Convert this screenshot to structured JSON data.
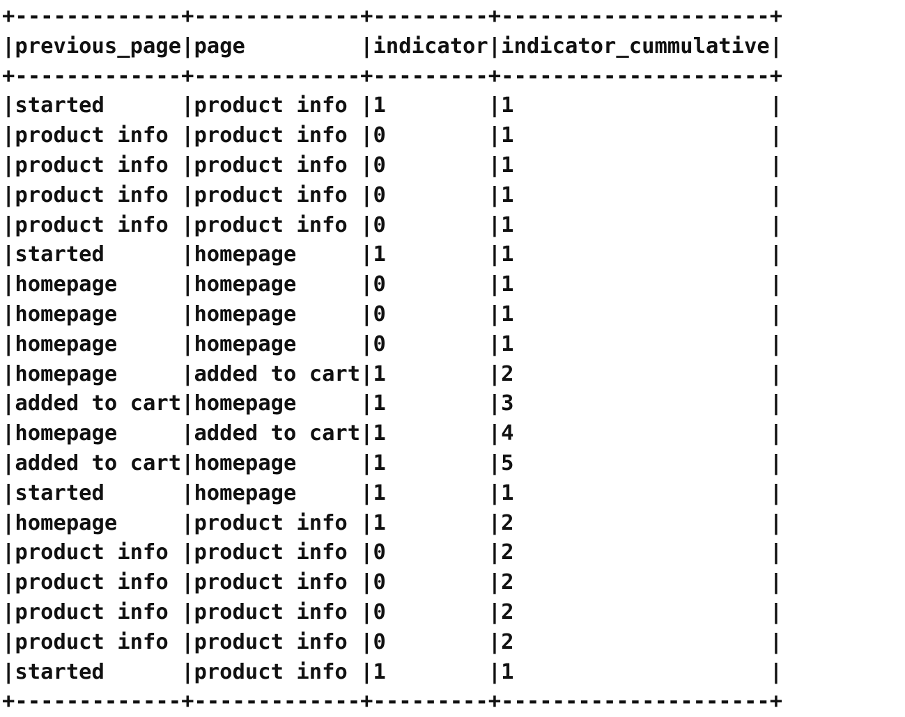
{
  "output": {
    "kind": "spark-dataframe-show",
    "border_corner": "+",
    "border_fill": "-",
    "cell_separator": "|",
    "columns": [
      {
        "name": "previous_page",
        "width": 13,
        "align": "left"
      },
      {
        "name": "page",
        "width": 13,
        "align": "left"
      },
      {
        "name": "indicator",
        "width": 9,
        "align": "left"
      },
      {
        "name": "indicator_cummulative",
        "width": 21,
        "align": "left"
      }
    ],
    "rows": [
      [
        "started",
        "product info",
        "1",
        "1"
      ],
      [
        "product info",
        "product info",
        "0",
        "1"
      ],
      [
        "product info",
        "product info",
        "0",
        "1"
      ],
      [
        "product info",
        "product info",
        "0",
        "1"
      ],
      [
        "product info",
        "product info",
        "0",
        "1"
      ],
      [
        "started",
        "homepage",
        "1",
        "1"
      ],
      [
        "homepage",
        "homepage",
        "0",
        "1"
      ],
      [
        "homepage",
        "homepage",
        "0",
        "1"
      ],
      [
        "homepage",
        "homepage",
        "0",
        "1"
      ],
      [
        "homepage",
        "added to cart",
        "1",
        "2"
      ],
      [
        "added to cart",
        "homepage",
        "1",
        "3"
      ],
      [
        "homepage",
        "added to cart",
        "1",
        "4"
      ],
      [
        "added to cart",
        "homepage",
        "1",
        "5"
      ],
      [
        "started",
        "homepage",
        "1",
        "1"
      ],
      [
        "homepage",
        "product info",
        "1",
        "2"
      ],
      [
        "product info",
        "product info",
        "0",
        "2"
      ],
      [
        "product info",
        "product info",
        "0",
        "2"
      ],
      [
        "product info",
        "product info",
        "0",
        "2"
      ],
      [
        "product info",
        "product info",
        "0",
        "2"
      ],
      [
        "started",
        "product info",
        "1",
        "1"
      ]
    ],
    "colors": {
      "background": "#ffffff",
      "text": "#111111"
    }
  }
}
